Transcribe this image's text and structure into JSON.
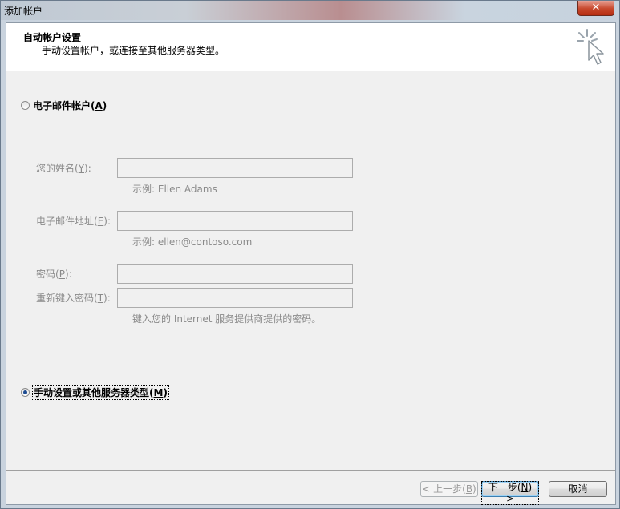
{
  "window": {
    "title": "添加帐户",
    "close_symbol": "✕"
  },
  "header": {
    "title": "自动帐户设置",
    "subtitle": "手动设置帐户，或连接至其他服务器类型。"
  },
  "options": {
    "email_account": {
      "label": "电子邮件帐户",
      "accel": "A",
      "checked": false
    },
    "manual_setup": {
      "label": "手动设置或其他服务器类型",
      "accel": "M",
      "checked": true
    }
  },
  "form": {
    "name": {
      "label": "您的姓名",
      "accel": "Y",
      "value": "",
      "hint": "示例: Ellen Adams"
    },
    "email": {
      "label": "电子邮件地址",
      "accel": "E",
      "value": "",
      "hint": "示例: ellen@contoso.com"
    },
    "password": {
      "label": "密码",
      "accel": "P",
      "value": ""
    },
    "password_confirm": {
      "label": "重新键入密码",
      "accel": "T",
      "value": "",
      "hint": "键入您的 Internet 服务提供商提供的密码。"
    }
  },
  "buttons": {
    "back": {
      "prefix": "< 上一步(",
      "accel": "B",
      "suffix": ")"
    },
    "next": {
      "prefix": "下一步(",
      "accel": "N",
      "suffix": ") >"
    },
    "cancel": "取消"
  }
}
